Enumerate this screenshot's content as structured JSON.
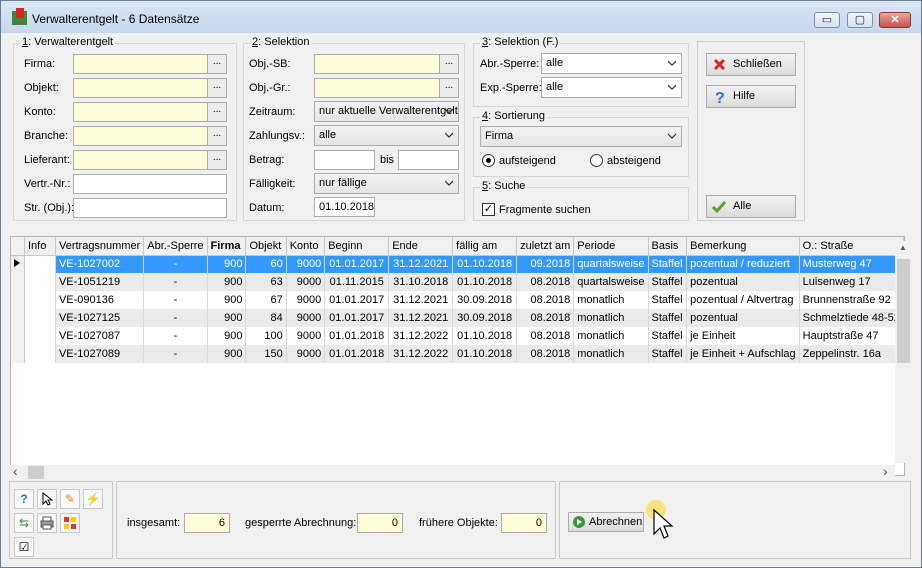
{
  "window": {
    "title": "Verwalterentgelt - 6 Datensätze",
    "min_glyph": "▭",
    "max_glyph": "▢",
    "close_glyph": "✕"
  },
  "group1": {
    "hotkey": "1",
    "title": ": Verwalterentgelt",
    "labels": {
      "firma": "Firma:",
      "objekt": "Objekt:",
      "konto": "Konto:",
      "branche": "Branche:",
      "lieferant": "Lieferant:",
      "vertr_nr": "Vertr.-Nr.:",
      "str_obj": "Str. (Obj.):"
    },
    "browse": "..."
  },
  "group2": {
    "hotkey": "2",
    "title": ": Selektion",
    "labels": {
      "obj_sb": "Obj.-SB:",
      "obj_gr": "Obj.-Gr.:",
      "zeitraum": "Zeitraum:",
      "zahlungsv": "Zahlungsv.:",
      "betrag": "Betrag:",
      "bis": "bis",
      "faelligkeit": "Fälligkeit:",
      "datum": "Datum:"
    },
    "zeitraum_value": "nur aktuelle Verwalterentgelte",
    "zahlungsv_value": "alle",
    "faelligkeit_value": "nur fällige",
    "datum_value": "01.10.2018"
  },
  "group3": {
    "hotkey": "3",
    "title": ": Selektion (F.)",
    "labels": {
      "abr_sperre": "Abr.-Sperre:",
      "exp_sperre": "Exp.-Sperre:"
    },
    "abr_sperre_value": "alle",
    "exp_sperre_value": "alle"
  },
  "group4": {
    "hotkey": "4",
    "title": ": Sortierung",
    "sort_value": "Firma",
    "asc": "aufsteigend",
    "desc": "absteigend"
  },
  "group5": {
    "hotkey": "5",
    "title": ": Suche",
    "fragmente": "Fragmente suchen"
  },
  "buttons": {
    "schliessen": "Schließen",
    "hilfe": "Hilfe",
    "alle": "Alle",
    "abrechnen": "Abrechnen"
  },
  "table": {
    "columns": [
      "Info",
      "Vertragsnummer",
      "Abr.-Sperre",
      "Firma",
      "Objekt",
      "Konto",
      "Beginn",
      "Ende",
      "fällig am",
      "zuletzt am",
      "Periode",
      "Basis",
      "Bemerkung",
      "O.: Straße"
    ],
    "rows": [
      [
        "",
        "VE-1027002",
        "-",
        "900",
        "60",
        "9000",
        "01.01.2017",
        "31.12.2021",
        "01.10.2018",
        "09.2018",
        "quartalsweise",
        "Staffel",
        "pozentual / reduziert",
        "Musterweg 47"
      ],
      [
        "",
        "VE-1051219",
        "-",
        "900",
        "63",
        "9000",
        "01.11.2015",
        "31.10.2018",
        "01.10.2018",
        "08.2018",
        "quartalsweise",
        "Staffel",
        "pozentual",
        "Luisenweg 17"
      ],
      [
        "",
        "VE-090136",
        "-",
        "900",
        "67",
        "9000",
        "01.01.2017",
        "31.12.2021",
        "30.09.2018",
        "08.2018",
        "monatlich",
        "Staffel",
        "pozentual / Altvertrag",
        "Brunnenstraße 92"
      ],
      [
        "",
        "VE-1027125",
        "-",
        "900",
        "84",
        "9000",
        "01.01.2017",
        "31.12.2021",
        "30.09.2018",
        "08.2018",
        "monatlich",
        "Staffel",
        "pozentual",
        "Schmelztiede 48-52"
      ],
      [
        "",
        "VE-1027087",
        "-",
        "900",
        "100",
        "9000",
        "01.01.2018",
        "31.12.2022",
        "01.10.2018",
        "08.2018",
        "monatlich",
        "Staffel",
        "je Einheit",
        "Hauptstraße 47"
      ],
      [
        "",
        "VE-1027089",
        "-",
        "900",
        "150",
        "9000",
        "01.01.2018",
        "31.12.2022",
        "01.10.2018",
        "08.2018",
        "monatlich",
        "Staffel",
        "je Einheit + Aufschlag",
        "Zeppelinstr. 16a"
      ]
    ]
  },
  "footer": {
    "insgesamt_label": "insgesamt:",
    "insgesamt_value": "6",
    "gesperrte_label": "gesperrte Abrechnung:",
    "gesperrte_value": "0",
    "fruehere_label": "frühere Objekte:",
    "fruehere_value": "0"
  },
  "scroll": {
    "left": "‹",
    "right": "›",
    "up": "▲"
  }
}
